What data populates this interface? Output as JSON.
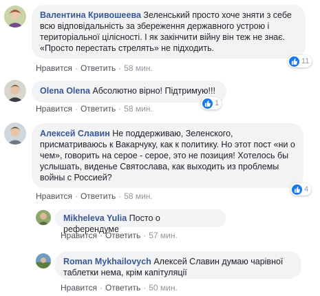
{
  "actions": {
    "like": "Нравится",
    "reply": "Ответить",
    "separator": "·"
  },
  "comments": [
    {
      "author": "Валентина Кривошеева",
      "text": "Зеленський просто хоче зняти з себе всю відповідальність за збереження державного устрою і територіальної цілісності. І як закінчити війну він теж не знає. «Просто перестать стрелять» не підходить.",
      "time": "58 мин.",
      "reactions": "11"
    },
    {
      "author": "Olena Olena",
      "text": "Абсолютно вірно! Підтримую!!!",
      "time": "58 мин.",
      "reactions": "1"
    },
    {
      "author": "Алексей Славин",
      "text": "Не поддерживаю, Зеленского, присматриваюсь к Вакарчуку, как к политику. Но этот пост «ни о чем», говорить на серое - серое, это не позиция! Хотелось бы услышать, виденье Святослава, как выходить из проблемы войны с Россией?",
      "time": "58 мин.",
      "reactions": "4"
    },
    {
      "author": "Mikheleva Yulia",
      "text": "Посто о референдуме",
      "time": "57 мин."
    },
    {
      "author": "Roman Mykhailovych",
      "text": "Алексей Славин думаю чарівної таблетки нема, крім капітуляції",
      "time": "50 мин."
    }
  ],
  "colors": {
    "author": "#385898",
    "bubble": "#f2f3f5",
    "like": "#1877f2",
    "meta": "#90949c"
  }
}
